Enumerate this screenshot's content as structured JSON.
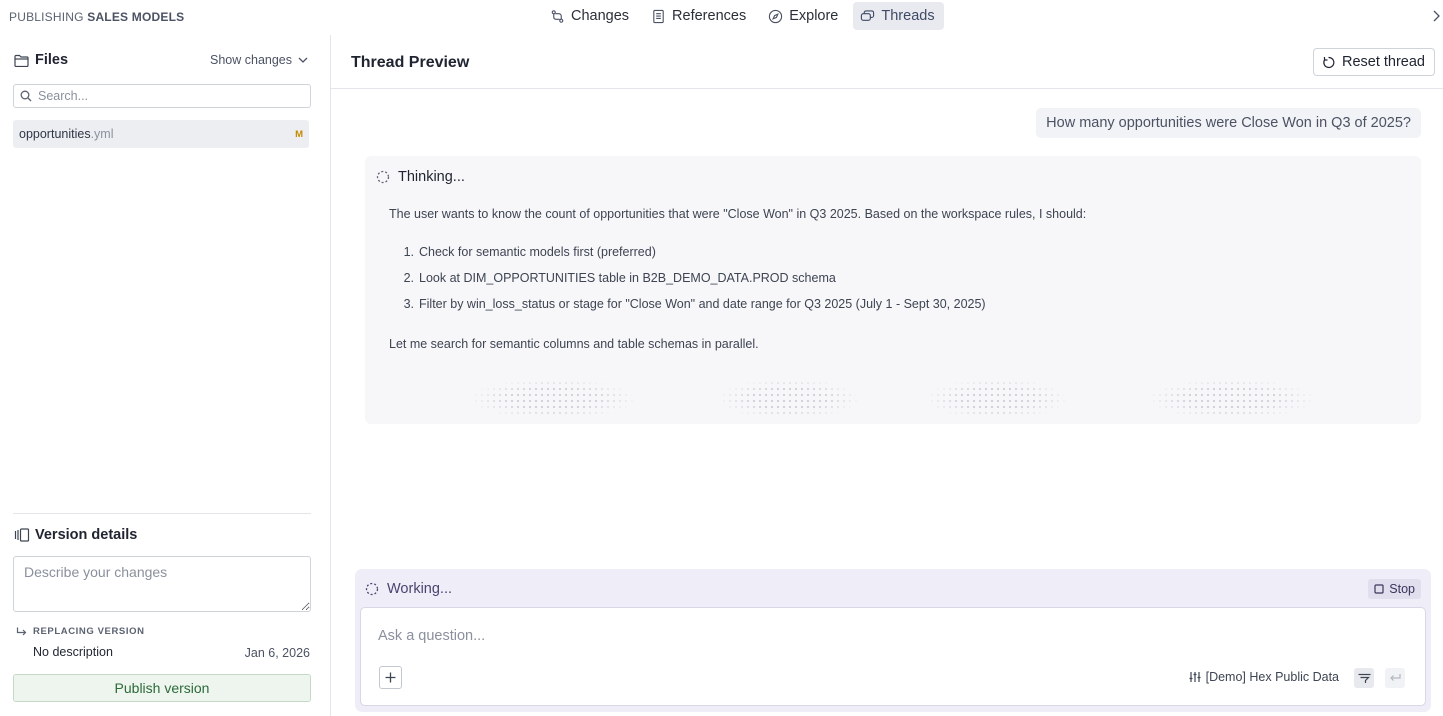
{
  "breadcrumb": {
    "prefix": "PUBLISHING",
    "name": "SALES MODELS"
  },
  "nav": {
    "tabs": [
      {
        "label": "Changes",
        "icon": "git-compare-icon"
      },
      {
        "label": "References",
        "icon": "document-icon"
      },
      {
        "label": "Explore",
        "icon": "compass-icon"
      },
      {
        "label": "Threads",
        "icon": "threads-icon",
        "active": true
      }
    ]
  },
  "sidebar": {
    "files_title": "Files",
    "show_changes_label": "Show changes",
    "search_placeholder": "Search...",
    "files": [
      {
        "name": "opportunities",
        "ext": ".yml",
        "status": "M"
      }
    ],
    "version": {
      "title": "Version details",
      "description_placeholder": "Describe your changes",
      "replacing_label": "REPLACING VERSION",
      "replacing_description": "No description",
      "replacing_date": "Jan 6, 2026",
      "publish_label": "Publish version"
    }
  },
  "main": {
    "title": "Thread Preview",
    "reset_label": "Reset thread",
    "user_message": "How many opportunities were Close Won in Q3 of 2025?",
    "thinking": {
      "status": "Thinking...",
      "intro": "The user wants to know the count of opportunities that were \"Close Won\" in Q3 2025. Based on the workspace rules, I should:",
      "steps": [
        "Check for semantic models first (preferred)",
        "Look at DIM_OPPORTUNITIES table in B2B_DEMO_DATA.PROD schema",
        "Filter by win_loss_status or stage for \"Close Won\" and date range for Q3 2025 (July 1 - Sept 30, 2025)"
      ],
      "outro": "Let me search for semantic columns and table schemas in parallel."
    },
    "composer": {
      "status": "Working...",
      "stop_label": "Stop",
      "placeholder": "Ask a question...",
      "datasource": "[Demo] Hex Public Data"
    }
  },
  "colors": {
    "active_tab_bg": "#e8eaf0",
    "modified_badge": "#c68a00",
    "publish_text": "#2c6a3a",
    "composer_bg": "#efedf7"
  }
}
